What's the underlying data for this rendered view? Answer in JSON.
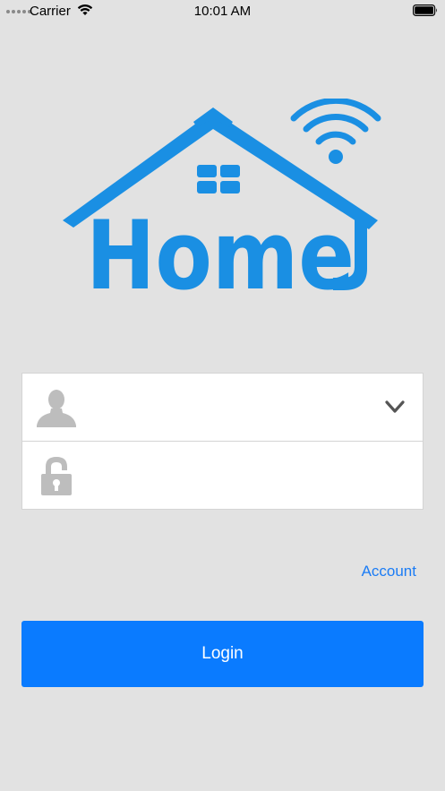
{
  "status_bar": {
    "carrier": "Carrier",
    "time": "10:01 AM"
  },
  "logo": {
    "text": "Home",
    "color": "#1a8fe3"
  },
  "login_form": {
    "username": {
      "value": "",
      "placeholder": "",
      "icon": "user-silhouette-icon"
    },
    "password": {
      "value": "",
      "placeholder": "",
      "icon": "padlock-icon"
    },
    "dropdown_icon": "chevron-down-icon"
  },
  "account_link": "Account",
  "login_button": {
    "label": "Login",
    "color": "#0a7bff"
  }
}
